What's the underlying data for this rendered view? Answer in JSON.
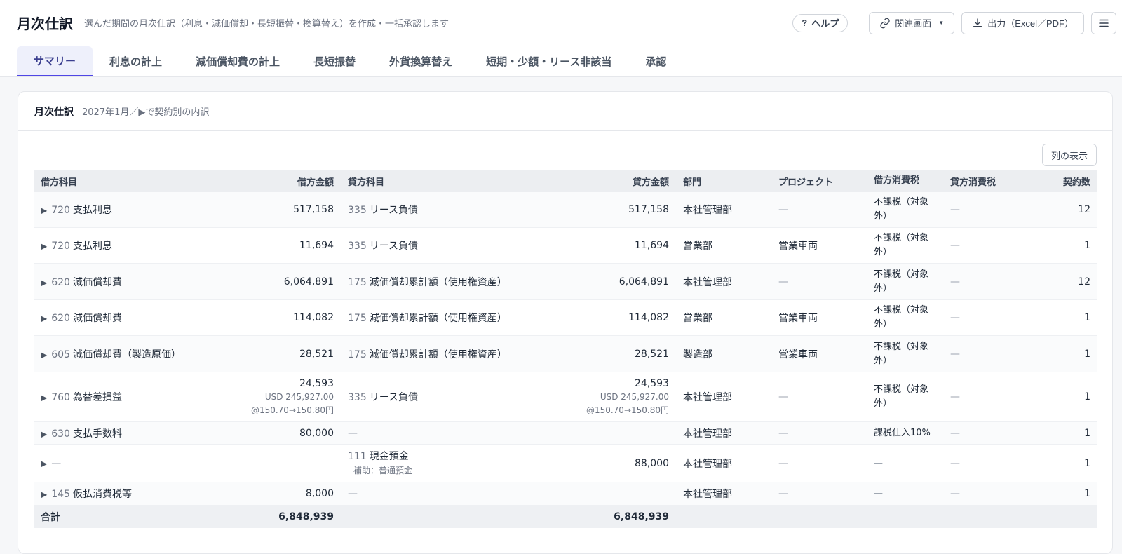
{
  "header": {
    "title": "月次仕訳",
    "subtitle": "選んだ期間の月次仕訳（利息・減価償却・長短振替・換算替え）を作成・一括承認します",
    "help_icon": "?",
    "help_label": "ヘルプ",
    "related_label": "関連画面",
    "export_label": "出力（Excel／PDF）"
  },
  "tabs": [
    {
      "label": "サマリー",
      "active": true
    },
    {
      "label": "利息の計上"
    },
    {
      "label": "減価償却費の計上"
    },
    {
      "label": "長短振替"
    },
    {
      "label": "外貨換算替え"
    },
    {
      "label": "短期・少額・リース非該当"
    },
    {
      "label": "承認"
    }
  ],
  "card": {
    "title": "月次仕訳",
    "subtitle": "2027年1月／▶で契約別の内訳",
    "columns_button": "列の表示"
  },
  "table": {
    "headers": [
      "借方科目",
      "借方金額",
      "貸方科目",
      "貸方金額",
      "部門",
      "プロジェクト",
      "借方消費税",
      "貸方消費税",
      "契約数"
    ],
    "expand_glyph": "▶",
    "dash": "—",
    "rows": [
      {
        "debit_code": "720",
        "debit_name": "支払利息",
        "debit_amount": "517,158",
        "credit_code": "335",
        "credit_name": "リース負債",
        "credit_amount": "517,158",
        "dept": "本社管理部",
        "project": "—",
        "debit_tax": "不課税（対象外）",
        "credit_tax": "—",
        "contracts": "12"
      },
      {
        "debit_code": "720",
        "debit_name": "支払利息",
        "debit_amount": "11,694",
        "credit_code": "335",
        "credit_name": "リース負債",
        "credit_amount": "11,694",
        "dept": "営業部",
        "project": "営業車両",
        "debit_tax": "不課税（対象外）",
        "credit_tax": "—",
        "contracts": "1"
      },
      {
        "debit_code": "620",
        "debit_name": "減価償却費",
        "debit_amount": "6,064,891",
        "credit_code": "175",
        "credit_name": "減価償却累計額（使用権資産）",
        "credit_amount": "6,064,891",
        "dept": "本社管理部",
        "project": "—",
        "debit_tax": "不課税（対象外）",
        "credit_tax": "—",
        "contracts": "12"
      },
      {
        "debit_code": "620",
        "debit_name": "減価償却費",
        "debit_amount": "114,082",
        "credit_code": "175",
        "credit_name": "減価償却累計額（使用権資産）",
        "credit_amount": "114,082",
        "dept": "営業部",
        "project": "営業車両",
        "debit_tax": "不課税（対象外）",
        "credit_tax": "—",
        "contracts": "1"
      },
      {
        "debit_code": "605",
        "debit_name": "減価償却費（製造原価）",
        "debit_amount": "28,521",
        "credit_code": "175",
        "credit_name": "減価償却累計額（使用権資産）",
        "credit_amount": "28,521",
        "dept": "製造部",
        "project": "営業車両",
        "debit_tax": "不課税（対象外）",
        "credit_tax": "—",
        "contracts": "1"
      },
      {
        "debit_code": "760",
        "debit_name": "為替差損益",
        "debit_amount": "24,593",
        "debit_fx": "USD 245,927.00",
        "debit_rate": "@150.70→150.80円",
        "credit_code": "335",
        "credit_name": "リース負債",
        "credit_amount": "24,593",
        "credit_fx": "USD 245,927.00",
        "credit_rate": "@150.70→150.80円",
        "dept": "本社管理部",
        "project": "—",
        "debit_tax": "不課税（対象外）",
        "credit_tax": "—",
        "contracts": "1"
      },
      {
        "debit_code": "630",
        "debit_name": "支払手数料",
        "debit_amount": "80,000",
        "credit_code": "",
        "credit_name": "—",
        "credit_amount": "",
        "dept": "本社管理部",
        "project": "—",
        "debit_tax": "課税仕入10%",
        "credit_tax": "—",
        "contracts": "1"
      },
      {
        "debit_code": "",
        "debit_name": "—",
        "debit_amount": "",
        "credit_code": "111",
        "credit_name": "現金預金",
        "credit_aux": "補助：普通預金",
        "credit_amount": "88,000",
        "dept": "本社管理部",
        "project": "—",
        "debit_tax": "—",
        "credit_tax": "—",
        "contracts": "1"
      },
      {
        "debit_code": "145",
        "debit_name": "仮払消費税等",
        "debit_amount": "8,000",
        "credit_code": "",
        "credit_name": "—",
        "credit_amount": "",
        "dept": "本社管理部",
        "project": "—",
        "debit_tax": "—",
        "credit_tax": "—",
        "contracts": "1"
      }
    ],
    "total": {
      "label": "合計",
      "debit_amount": "6,848,939",
      "credit_amount": "6,848,939"
    }
  }
}
